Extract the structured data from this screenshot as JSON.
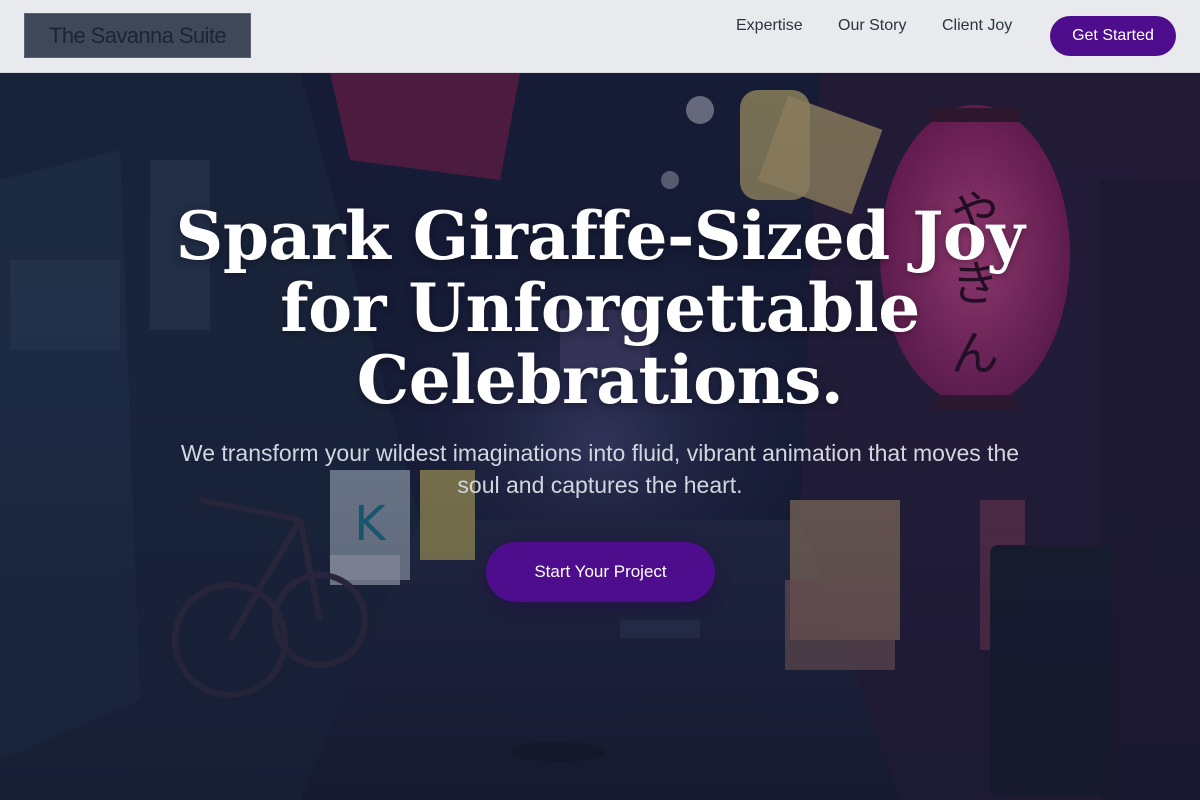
{
  "brand": {
    "name": "The Savanna Suite"
  },
  "nav": {
    "links": [
      "Expertise",
      "Our Story",
      "Client Joy"
    ],
    "cta_label": "Get Started"
  },
  "hero": {
    "title": "Spark Giraffe-Sized Joy for Unforgettable Celebrations.",
    "subtitle": "We transform your wildest imaginations into fluid, vibrant animation that moves the soul and captures the heart.",
    "cta_label": "Start Your Project"
  },
  "colors": {
    "accent": "#4e0d8c",
    "header_bg": "#e9eaed",
    "hero_text": "#ffffff",
    "hero_subtext": "#d3d6de"
  }
}
